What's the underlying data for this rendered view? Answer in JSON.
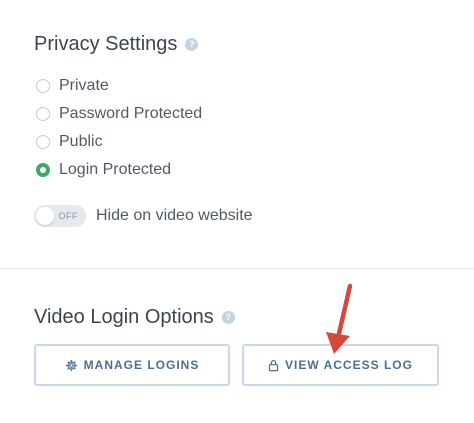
{
  "privacy": {
    "title": "Privacy Settings",
    "help_icon": "question-mark",
    "options": [
      {
        "label": "Private",
        "checked": false
      },
      {
        "label": "Password Protected",
        "checked": false
      },
      {
        "label": "Public",
        "checked": false
      },
      {
        "label": "Login Protected",
        "checked": true
      }
    ],
    "toggle": {
      "state_text": "OFF",
      "label": "Hide on video website",
      "on": false
    }
  },
  "login_options": {
    "title": "Video Login Options",
    "help_icon": "question-mark",
    "manage_button": {
      "label": "MANAGE LOGINS",
      "icon": "gear-icon"
    },
    "access_log_button": {
      "label": "VIEW ACCESS LOG",
      "icon": "lock-icon"
    }
  },
  "colors": {
    "accent_green": "#3fa76b",
    "button_text": "#4c6f91",
    "button_border": "#c8d9ea",
    "annotation_arrow": "#d9473a"
  }
}
